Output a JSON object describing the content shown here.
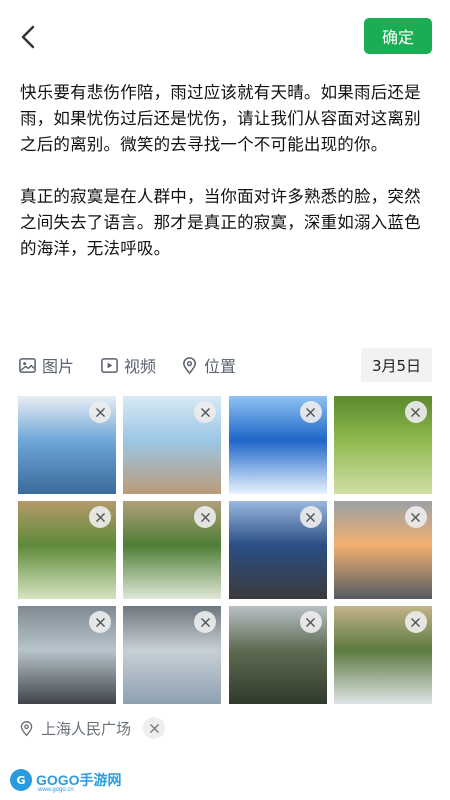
{
  "header": {
    "confirm_label": "确定"
  },
  "post": {
    "paragraphs": [
      "快乐要有悲伤作陪，雨过应该就有天晴。如果雨后还是雨，如果忧伤过后还是忧伤，请让我们从容面对这离别之后的离别。微笑的去寻找一个不可能出现的你。",
      "真正的寂寞是在人群中，当你面对许多熟悉的脸，突然之间失去了语言。那才是真正的寂寞，深重如溺入蓝色的海洋，无法呼吸。"
    ]
  },
  "toolbar": {
    "image_label": "图片",
    "video_label": "视频",
    "location_label": "位置",
    "date": "3月5日"
  },
  "photos": [
    {
      "scene": "canal-town-snow",
      "colors": [
        "#6fa7d8",
        "#e9eef4",
        "#3a6a9a"
      ]
    },
    {
      "scene": "seagulls-over-water",
      "colors": [
        "#9cc7e6",
        "#d8e9f4",
        "#b99b78"
      ]
    },
    {
      "scene": "anime-sky-clouds",
      "colors": [
        "#1e66c8",
        "#8fc3f2",
        "#e8f3ff"
      ]
    },
    {
      "scene": "green-grassland",
      "colors": [
        "#8fb84e",
        "#5a8a2c",
        "#cfe0a6"
      ]
    },
    {
      "scene": "park-tent-pond",
      "colors": [
        "#5e8a3a",
        "#b59a6a",
        "#d7e4c2"
      ]
    },
    {
      "scene": "park-pond-trees",
      "colors": [
        "#4f7d35",
        "#b0a07a",
        "#dfe8d8"
      ]
    },
    {
      "scene": "road-car-dashboard",
      "colors": [
        "#2a4f86",
        "#9ab8de",
        "#3a3a3a"
      ]
    },
    {
      "scene": "waterfront-sunset",
      "colors": [
        "#f2b070",
        "#9aa0a6",
        "#555b62"
      ]
    },
    {
      "scene": "lake-city-skyline",
      "colors": [
        "#b8c4cc",
        "#7f8a92",
        "#3f444a"
      ]
    },
    {
      "scene": "lakeshore-rocks",
      "colors": [
        "#c7d0d6",
        "#6f777e",
        "#8ea0b0"
      ]
    },
    {
      "scene": "mountain-cliff-valley",
      "colors": [
        "#5e6b52",
        "#b8c0c4",
        "#2f3a2a"
      ]
    },
    {
      "scene": "mountain-waterfall",
      "colors": [
        "#5b7a3e",
        "#c4b48a",
        "#dfe4e8"
      ]
    }
  ],
  "location": {
    "name": "上海人民广场"
  },
  "watermark": {
    "brand": "GOGO手游网",
    "url": "www.gogo.cn"
  },
  "icons": {
    "back": "chevron-left-icon",
    "image": "image-icon",
    "video": "video-icon",
    "location": "location-pin-icon",
    "remove": "close-icon"
  },
  "colors": {
    "accent": "#1aad54",
    "toolbar_text": "#5a6270",
    "watermark": "#2b9be0"
  }
}
